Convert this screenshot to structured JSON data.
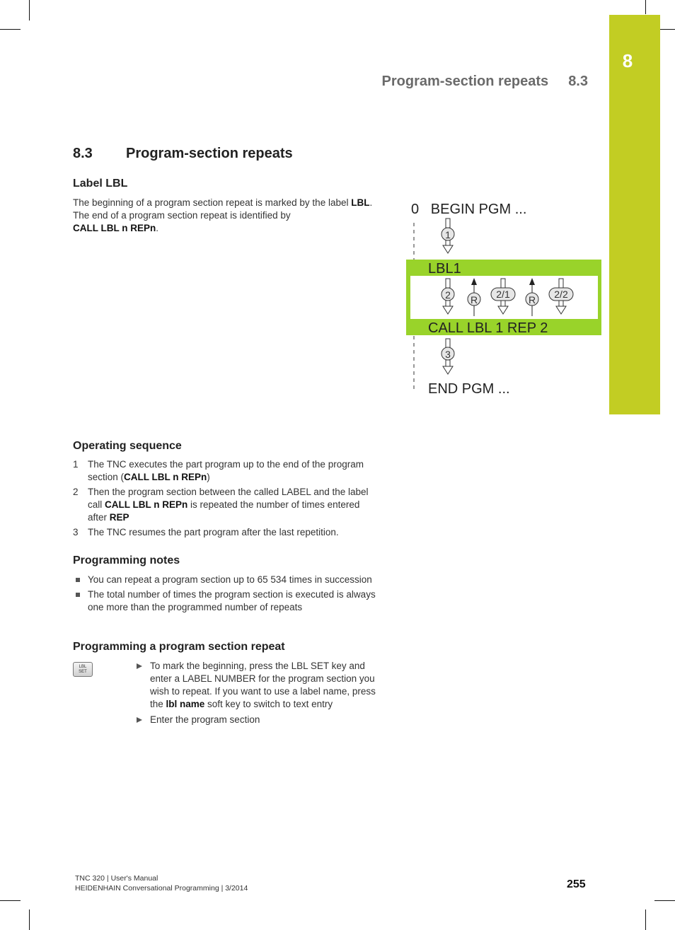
{
  "running_header": {
    "title": "Program-section repeats",
    "number": "8.3"
  },
  "chapter_tab": {
    "number": "8",
    "color": "#c2cd23"
  },
  "section": {
    "number": "8.3",
    "title": "Program-section repeats"
  },
  "label_lbl": {
    "heading": "Label LBL",
    "text_1": "The beginning of a program section repeat is marked by the label ",
    "bold_1": "LBL",
    "text_2": ". The end of a program section repeat is identified by ",
    "bold_2": "CALL LBL n REPn",
    "text_3": "."
  },
  "diagram": {
    "accent_color": "#99d32a",
    "lines": {
      "begin": "0   BEGIN PGM ...",
      "label": "LBL1",
      "call": "CALL LBL 1 REP 2",
      "end": "END PGM ..."
    },
    "steps": [
      "1",
      "2",
      "R",
      "2/1",
      "R",
      "2/2",
      "3"
    ]
  },
  "operating_sequence": {
    "heading": "Operating sequence",
    "items": [
      {
        "num": "1",
        "text_1": "The TNC executes the part program up to the end of the program section (",
        "bold": "CALL LBL n REPn",
        "text_2": ")"
      },
      {
        "num": "2",
        "text_1": "Then the program section between the called LABEL and the label call ",
        "bold": "CALL LBL n REPn",
        "text_2": " is repeated the number of times entered after ",
        "bold_2": "REP"
      },
      {
        "num": "3",
        "text_1": "The TNC resumes the part program after the last repetition."
      }
    ]
  },
  "programming_notes": {
    "heading": "Programming notes",
    "items": [
      "You can repeat a program section up to 65 534 times in succession",
      "The total number of times the program section is executed is always one more than the programmed number of repeats"
    ]
  },
  "programming_repeat": {
    "heading": "Programming a program section repeat",
    "key_label_line1": "LBL",
    "key_label_line2": "SET",
    "steps": [
      {
        "text_1": "To mark the beginning, press the LBL SET key and enter a LABEL NUMBER for the program section you wish to repeat. If you want to use a label name, press the ",
        "bold": "lbl name",
        "text_2": " soft key to switch to text entry"
      },
      {
        "text_1": "Enter the program section"
      }
    ]
  },
  "footer": {
    "line1": "TNC 320 | User's Manual",
    "line2": "HEIDENHAIN Conversational Programming | 3/2014",
    "page_number": "255"
  }
}
